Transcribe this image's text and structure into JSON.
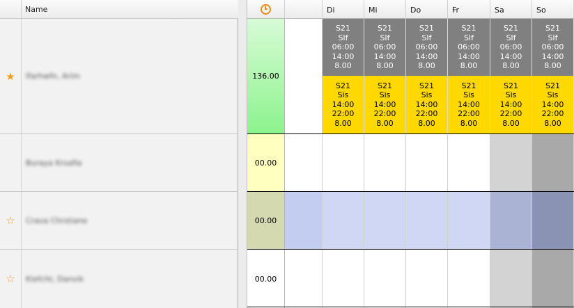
{
  "left": {
    "name_header": "Name",
    "rows": [
      {
        "name": "Ifarhwfn, Arim",
        "star": "★"
      },
      {
        "name": "Buraya Krsafia",
        "star": ""
      },
      {
        "name": "Crava Chrstiane",
        "star": "☆"
      },
      {
        "name": "Kiefcht, Danvik",
        "star": "☆"
      }
    ]
  },
  "grid": {
    "days": [
      "Di",
      "Mi",
      "Do",
      "Fr",
      "Sa",
      "So"
    ],
    "hours": [
      "136.00",
      "00.00",
      "00.00",
      "00.00"
    ],
    "shift_a": [
      "S21",
      "SIf",
      "06:00",
      "14:00",
      "8.00"
    ],
    "shift_b": [
      "S21",
      "Sis",
      "14:00",
      "22:00",
      "8.00"
    ]
  },
  "colors": {
    "shift_a_bg": "#808080",
    "shift_b_bg": "#ffd800",
    "hours_green": "#8cf38c",
    "hours_yellow": "#ffffc0",
    "hours_olive": "#d4d9b0",
    "selected_row": "#cfd7f5",
    "weekend_light": "#d3d3d3",
    "weekend_dark": "#a9a9a9",
    "accent_star": "#f19b1c"
  }
}
